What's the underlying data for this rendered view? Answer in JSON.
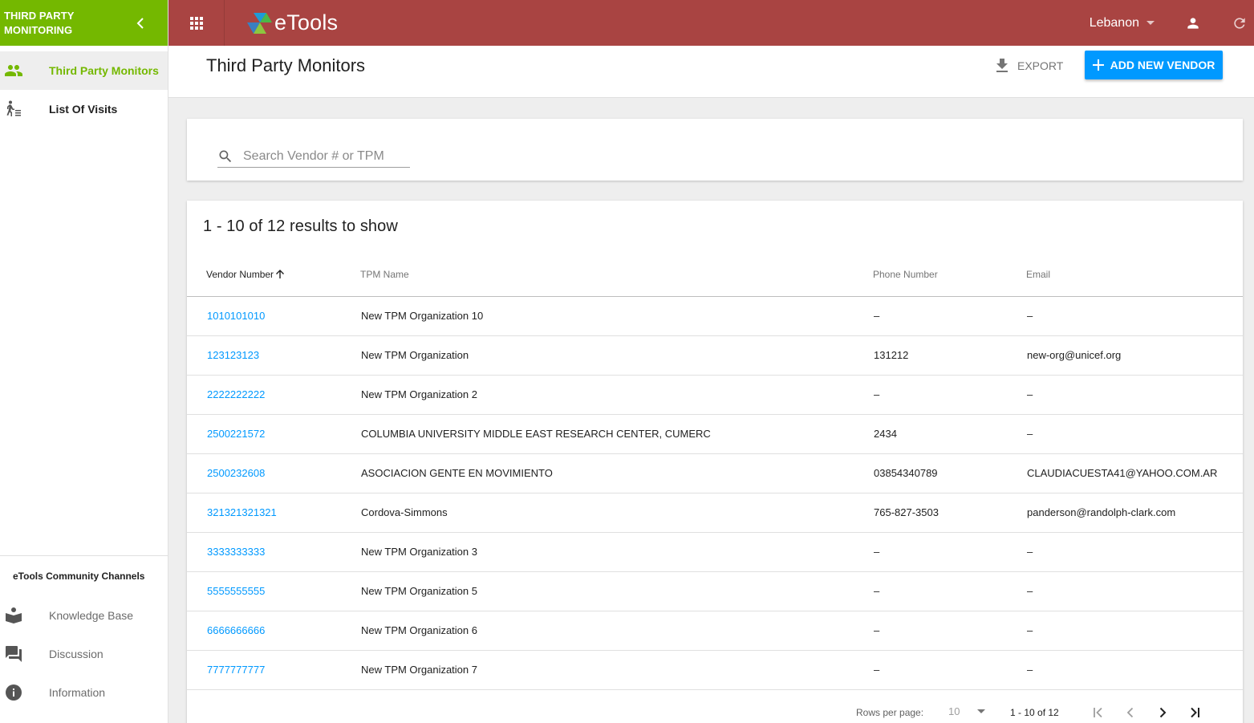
{
  "app": {
    "module_title_line1": "THIRD PARTY",
    "module_title_line2": "MONITORING",
    "logo_text": "eTools",
    "country": "Lebanon"
  },
  "colors": {
    "module_green": "#74b800",
    "topbar_red": "#a94442",
    "primary_blue": "#0099ff"
  },
  "sidebar": {
    "items": [
      {
        "label": "Third Party Monitors",
        "icon": "people-icon",
        "active": true
      },
      {
        "label": "List Of Visits",
        "icon": "visits-icon",
        "active": false
      }
    ],
    "community_title": "eTools Community Channels",
    "community": [
      {
        "label": "Knowledge Base",
        "icon": "book-reader-icon"
      },
      {
        "label": "Discussion",
        "icon": "chat-icon"
      },
      {
        "label": "Information",
        "icon": "info-icon"
      }
    ]
  },
  "header": {
    "title": "Third Party Monitors",
    "export_label": "EXPORT",
    "add_label": "ADD NEW VENDOR"
  },
  "search": {
    "placeholder": "Search Vendor # or TPM",
    "value": ""
  },
  "table": {
    "results_text": "1 - 10 of 12 results to show",
    "columns": [
      "Vendor Number",
      "TPM Name",
      "Phone Number",
      "Email"
    ],
    "sorted_column": "Vendor Number",
    "sort_direction": "ascending",
    "rows": [
      {
        "vendor": "1010101010",
        "name": "New TPM Organization 10",
        "phone": "–",
        "email": "–"
      },
      {
        "vendor": "123123123",
        "name": "New TPM Organization",
        "phone": "131212",
        "email": "new-org@unicef.org"
      },
      {
        "vendor": "2222222222",
        "name": "New TPM Organization 2",
        "phone": "–",
        "email": "–"
      },
      {
        "vendor": "2500221572",
        "name": "COLUMBIA UNIVERSITY MIDDLE EAST RESEARCH CENTER, CUMERC",
        "phone": "2434",
        "email": "–"
      },
      {
        "vendor": "2500232608",
        "name": "ASOCIACION GENTE EN MOVIMIENTO",
        "phone": "03854340789",
        "email": "CLAUDIACUESTA41@YAHOO.COM.AR"
      },
      {
        "vendor": "321321321321",
        "name": "Cordova-Simmons",
        "phone": "765-827-3503",
        "email": "panderson@randolph-clark.com"
      },
      {
        "vendor": "3333333333",
        "name": "New TPM Organization 3",
        "phone": "–",
        "email": "–"
      },
      {
        "vendor": "5555555555",
        "name": "New TPM Organization 5",
        "phone": "–",
        "email": "–"
      },
      {
        "vendor": "6666666666",
        "name": "New TPM Organization 6",
        "phone": "–",
        "email": "–"
      },
      {
        "vendor": "7777777777",
        "name": "New TPM Organization 7",
        "phone": "–",
        "email": "–"
      }
    ]
  },
  "pagination": {
    "rows_per_page_label": "Rows per page:",
    "rows_per_page": "10",
    "range": "1 - 10 of 12"
  }
}
